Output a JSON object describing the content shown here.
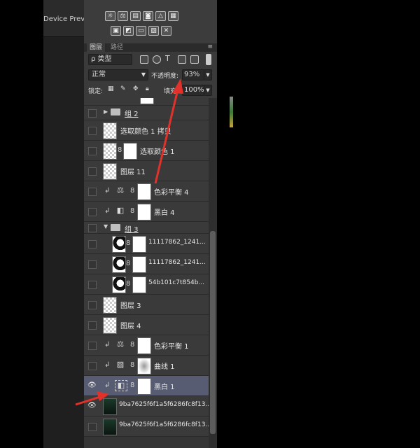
{
  "left_panel": {
    "device_tab_label": "Device Prev..."
  },
  "tabs": [
    {
      "label": "图层"
    },
    {
      "label": "路径"
    }
  ],
  "filter": {
    "kind_label": "ρ 类型"
  },
  "blend": {
    "mode": "正常",
    "opacity_label": "不透明度:",
    "opacity_value": "93%"
  },
  "lock": {
    "label": "锁定:",
    "fill_label": "填充:",
    "fill_value": "100%"
  },
  "layers": [
    {
      "name": "组 2"
    },
    {
      "name": "选取颜色 1 拷贝"
    },
    {
      "name": "选取颜色 1"
    },
    {
      "name": "图层 11"
    },
    {
      "name": "色彩平衡 4"
    },
    {
      "name": "黑白 4"
    },
    {
      "name": "组 3"
    },
    {
      "name": "11117862_1241..."
    },
    {
      "name": "11117862_1241..."
    },
    {
      "name": "54b101c7t854b..."
    },
    {
      "name": "图层 3"
    },
    {
      "name": "图层 4"
    },
    {
      "name": "色彩平衡 1"
    },
    {
      "name": "曲线 1"
    },
    {
      "name": "黑白 1"
    },
    {
      "name": "9ba7625f6f1a5f6286fc8f13..."
    },
    {
      "name": "9ba7625f6f1a5f6286fc8f13..."
    }
  ],
  "colors": {
    "selected_row": "#575c73",
    "arrow": "#e0322b"
  }
}
